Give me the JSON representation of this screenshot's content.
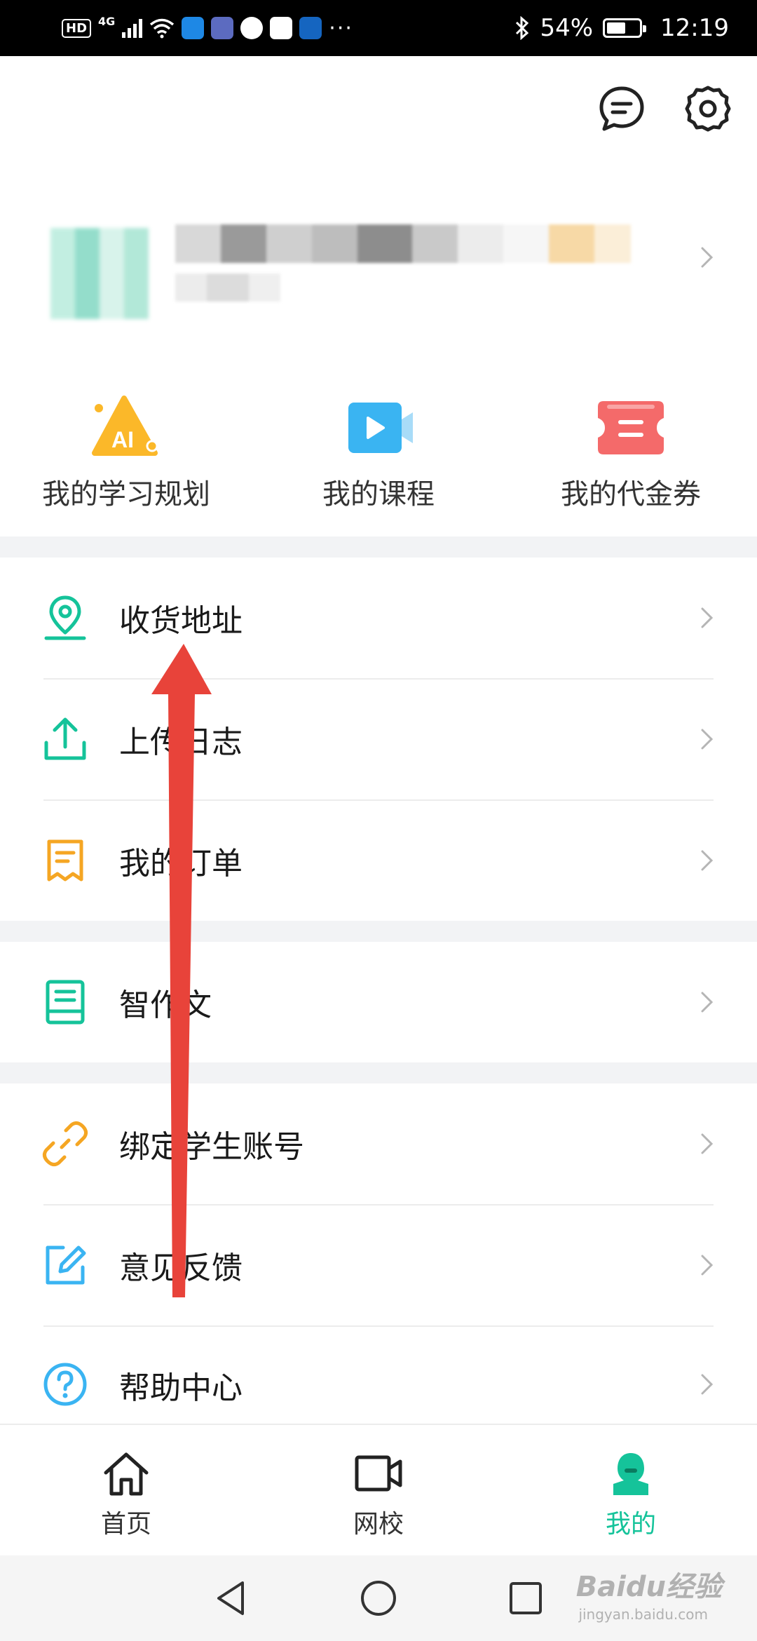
{
  "status_bar": {
    "hd": "HD",
    "network": "4G",
    "more": "···",
    "battery": "54%",
    "time": "12:19",
    "app_icons": [
      {
        "name": "search-app-icon",
        "color": "#1e88e5"
      },
      {
        "name": "music-app-icon",
        "color": "#5c6bc0"
      },
      {
        "name": "browser-app-icon",
        "color": "#ffffff"
      },
      {
        "name": "huawei-app-icon",
        "color": "#ffffff"
      },
      {
        "name": "car-home-app-icon",
        "color": "#1565c0"
      }
    ]
  },
  "header": {
    "message_icon": "chat-bubble-icon",
    "settings_icon": "gear-icon"
  },
  "quick_actions": [
    {
      "label": "我的学习规划",
      "icon": "ai-plan-icon",
      "color": "#fbb829"
    },
    {
      "label": "我的课程",
      "icon": "video-course-icon",
      "color": "#3ab4f2"
    },
    {
      "label": "我的代金券",
      "icon": "coupon-icon",
      "color": "#f46a6a"
    }
  ],
  "menu": [
    {
      "label": "收货地址",
      "icon": "location-pin-icon",
      "color": "#15c39a"
    },
    {
      "label": "上传日志",
      "icon": "upload-icon",
      "color": "#15c39a"
    },
    {
      "label": "我的订单",
      "icon": "receipt-icon",
      "color": "#f5a623"
    },
    {
      "label": "智作文",
      "icon": "notebook-icon",
      "color": "#15c39a"
    },
    {
      "label": "绑定学生账号",
      "icon": "link-icon",
      "color": "#f5a623"
    },
    {
      "label": "意见反馈",
      "icon": "edit-icon",
      "color": "#3ab4f2"
    },
    {
      "label": "帮助中心",
      "icon": "help-icon",
      "color": "#3ab4f2"
    }
  ],
  "bottom_nav": [
    {
      "label": "首页",
      "icon": "home-icon",
      "active": false
    },
    {
      "label": "网校",
      "icon": "video-camera-icon",
      "active": false
    },
    {
      "label": "我的",
      "icon": "profile-icon",
      "active": true
    }
  ],
  "accent_color": "#15c39a",
  "annotation_arrow_color": "#e8433a",
  "watermark": {
    "text": "Baidu经验",
    "sub": "jingyan.baidu.com"
  }
}
